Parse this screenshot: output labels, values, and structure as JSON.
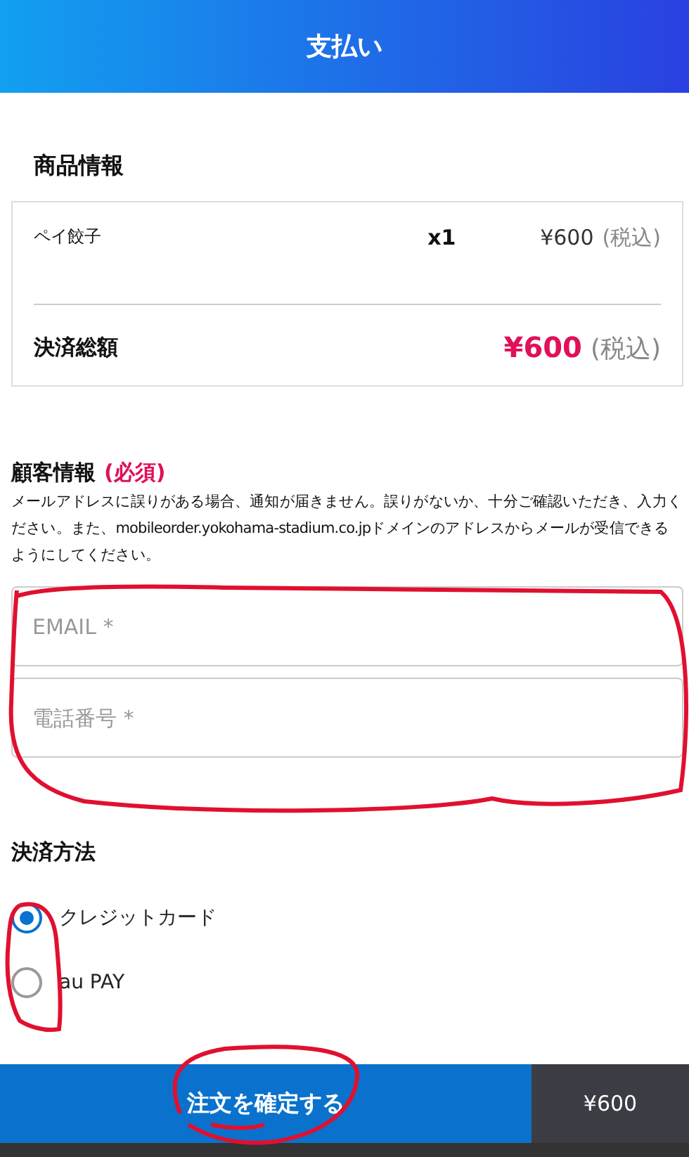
{
  "header": {
    "title": "支払い"
  },
  "product_section": {
    "title": "商品情報",
    "items": [
      {
        "name": "ペイ餃子",
        "quantity": "x1",
        "price": "¥600",
        "tax_note": "(税込)"
      }
    ],
    "total": {
      "label": "決済総額",
      "amount": "¥600",
      "tax_note": "(税込)"
    }
  },
  "customer_section": {
    "title": "顧客情報",
    "required_tag": "(必須)",
    "notice": "メールアドレスに誤りがある場合、通知が届きません。誤りがないか、十分ご確認いただき、入力ください。また、mobileorder.yokohama-stadium.co.jpドメインのアドレスからメールが受信できるようにしてください。",
    "fields": [
      {
        "placeholder": "EMAIL *"
      },
      {
        "placeholder": "電話番号 *"
      }
    ]
  },
  "payment_section": {
    "title": "決済方法",
    "methods": [
      {
        "label": "クレジットカード",
        "selected": true
      },
      {
        "label": "au PAY",
        "selected": false
      }
    ]
  },
  "footer": {
    "confirm_button": "注文を確定する",
    "total": "¥600"
  }
}
